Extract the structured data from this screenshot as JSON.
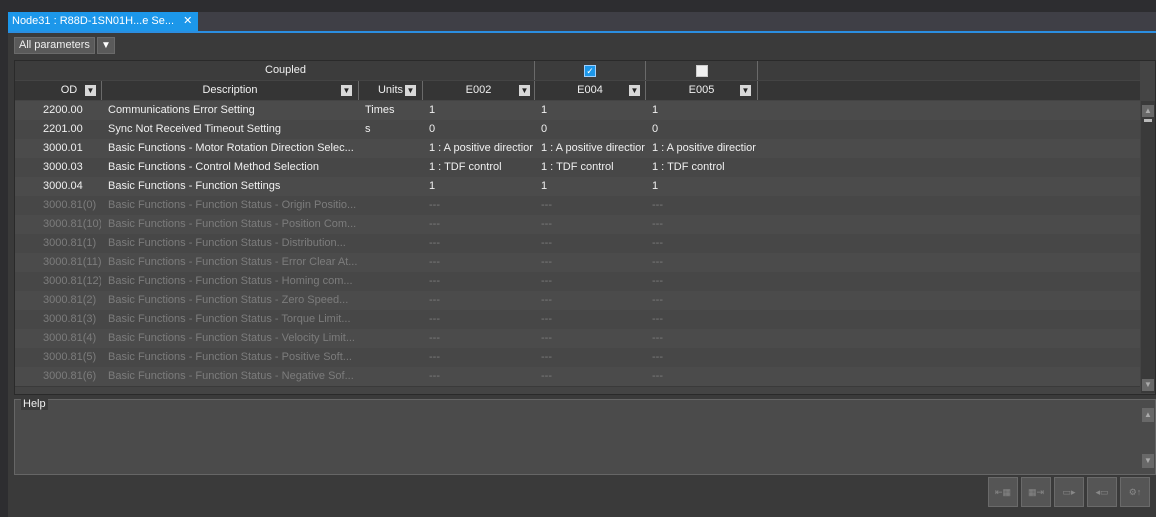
{
  "tab": {
    "title": "Node31 : R88D-1SN01H...e Se..."
  },
  "filter": {
    "label": "All parameters"
  },
  "grid": {
    "group_header": "Coupled",
    "columns": [
      "OD",
      "Description",
      "Units",
      "E002",
      "E004",
      "E005"
    ],
    "e004_checked": true,
    "e005_checked": false,
    "rows": [
      {
        "od": "2200.00",
        "desc": "Communications Error Setting",
        "units": "Times",
        "e002": "1",
        "e004": "1",
        "e005": "1",
        "enabled": true
      },
      {
        "od": "2201.00",
        "desc": "Sync Not Received Timeout Setting",
        "units": "s",
        "e002": "0",
        "e004": "0",
        "e005": "0",
        "enabled": true
      },
      {
        "od": "3000.01",
        "desc": "Basic Functions - Motor Rotation Direction Selec...",
        "units": "",
        "e002": "1 : A positive directior",
        "e004": "1 : A positive directior",
        "e005": "1 : A positive directior",
        "enabled": true
      },
      {
        "od": "3000.03",
        "desc": "Basic Functions - Control Method Selection",
        "units": "",
        "e002": "1 : TDF control",
        "e004": "1 : TDF control",
        "e005": "1 : TDF control",
        "enabled": true
      },
      {
        "od": "3000.04",
        "desc": "Basic Functions - Function Settings",
        "units": "",
        "e002": "1",
        "e004": "1",
        "e005": "1",
        "enabled": true
      },
      {
        "od": "3000.81(0)",
        "desc": "Basic Functions - Function Status - Origin Positio...",
        "units": "",
        "e002": "---",
        "e004": "---",
        "e005": "---",
        "enabled": false
      },
      {
        "od": "3000.81(10)",
        "desc": "Basic Functions - Function Status - Position Com...",
        "units": "",
        "e002": "---",
        "e004": "---",
        "e005": "---",
        "enabled": false
      },
      {
        "od": "3000.81(1)",
        "desc": "Basic Functions - Function Status - Distribution...",
        "units": "",
        "e002": "---",
        "e004": "---",
        "e005": "---",
        "enabled": false
      },
      {
        "od": "3000.81(11)",
        "desc": "Basic Functions - Function Status - Error Clear At...",
        "units": "",
        "e002": "---",
        "e004": "---",
        "e005": "---",
        "enabled": false
      },
      {
        "od": "3000.81(12)",
        "desc": "Basic Functions - Function Status - Homing com...",
        "units": "",
        "e002": "---",
        "e004": "---",
        "e005": "---",
        "enabled": false
      },
      {
        "od": "3000.81(2)",
        "desc": "Basic Functions - Function Status - Zero Speed...",
        "units": "",
        "e002": "---",
        "e004": "---",
        "e005": "---",
        "enabled": false
      },
      {
        "od": "3000.81(3)",
        "desc": "Basic Functions - Function Status - Torque Limit...",
        "units": "",
        "e002": "---",
        "e004": "---",
        "e005": "---",
        "enabled": false
      },
      {
        "od": "3000.81(4)",
        "desc": "Basic Functions - Function Status - Velocity Limit...",
        "units": "",
        "e002": "---",
        "e004": "---",
        "e005": "---",
        "enabled": false
      },
      {
        "od": "3000.81(5)",
        "desc": "Basic Functions - Function Status - Positive Soft...",
        "units": "",
        "e002": "---",
        "e004": "---",
        "e005": "---",
        "enabled": false
      },
      {
        "od": "3000.81(6)",
        "desc": "Basic Functions - Function Status - Negative Sof...",
        "units": "",
        "e002": "---",
        "e004": "---",
        "e005": "---",
        "enabled": false
      }
    ]
  },
  "help": {
    "label": "Help"
  },
  "toolbar": {
    "icons": [
      "compare-left-icon",
      "compare-right-icon",
      "transfer-to-icon",
      "transfer-from-icon",
      "settings-upload-icon"
    ]
  }
}
